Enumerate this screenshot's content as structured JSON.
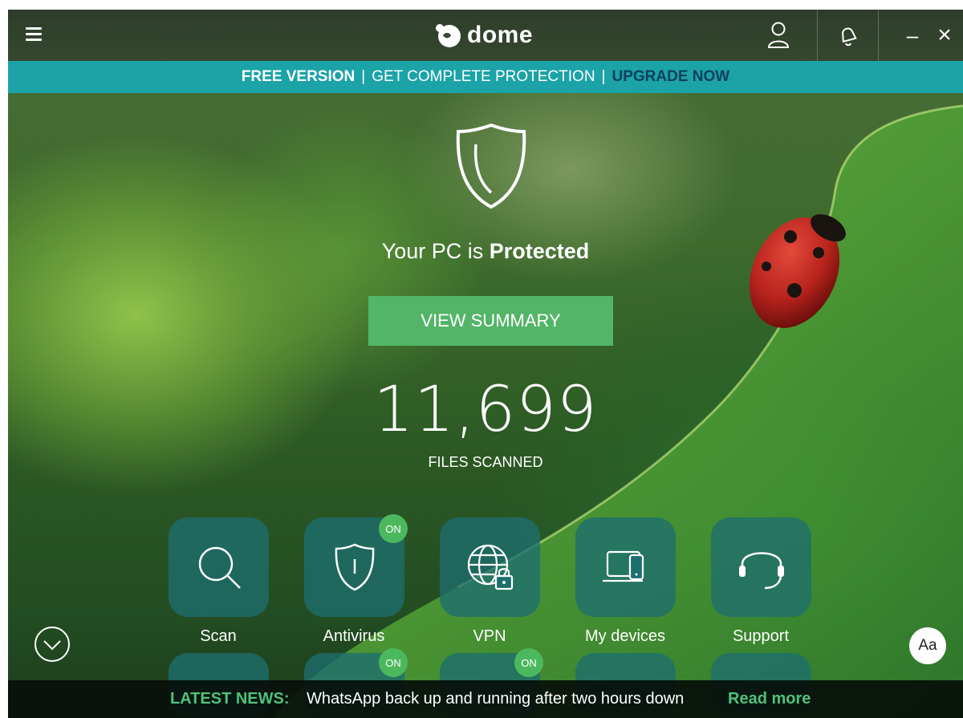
{
  "app": {
    "name": "dome",
    "menu_icon": "hamburger-menu-icon",
    "account_icon": "user-icon",
    "notifications_icon": "bell-icon",
    "minimize_label": "–",
    "close_label": "×"
  },
  "banner": {
    "free_version": "FREE VERSION",
    "separator": "|",
    "message": "GET COMPLETE PROTECTION",
    "upgrade": "UPGRADE NOW"
  },
  "status": {
    "prefix": "Your PC is",
    "state": "Protected",
    "shield_icon": "shield-icon"
  },
  "summary_button": "VIEW SUMMARY",
  "scan_stats": {
    "count": "11,699",
    "label": "FILES SCANNED"
  },
  "tiles": [
    {
      "label": "Scan",
      "icon": "magnifier-icon",
      "badge": ""
    },
    {
      "label": "Antivirus",
      "icon": "shield-icon",
      "badge": "ON"
    },
    {
      "label": "VPN",
      "icon": "globe-lock-icon",
      "badge": ""
    },
    {
      "label": "My devices",
      "icon": "devices-icon",
      "badge": ""
    },
    {
      "label": "Support",
      "icon": "headset-icon",
      "badge": ""
    }
  ],
  "tiles_row2_badges": [
    "",
    "ON",
    "ON",
    "",
    ""
  ],
  "font_size_button": "Aa",
  "news": {
    "label": "LATEST NEWS:",
    "headline": "WhatsApp back up and running after two hours down",
    "read_more": "Read more"
  },
  "colors": {
    "banner": "#1ba3a8",
    "upgrade_text": "#0f3f5f",
    "summary_button": "#53b567",
    "tile": "#1e6e6e",
    "on_badge": "#4cb85e",
    "news_accent": "#4fc27a"
  }
}
